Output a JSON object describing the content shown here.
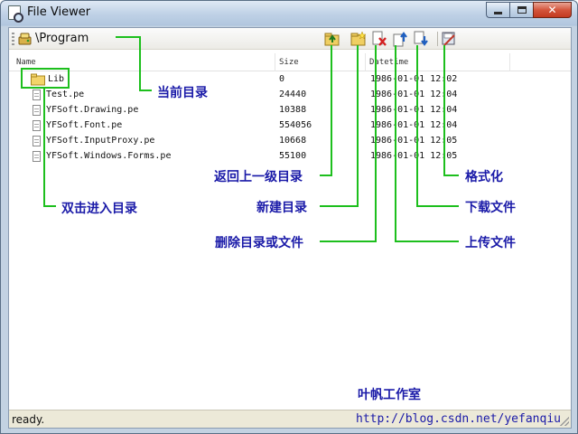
{
  "window": {
    "title": "File Viewer"
  },
  "caption_buttons": {
    "close_glyph": "✕"
  },
  "toolbar": {
    "path": "\\Program",
    "buttons": [
      "go-up-icon",
      "new-folder-icon",
      "delete-icon",
      "upload-icon",
      "download-icon",
      "format-icon"
    ]
  },
  "list": {
    "columns": [
      "Name",
      "Size",
      "Datetime"
    ],
    "rows": [
      {
        "name": "Lib",
        "size": "0",
        "datetime": "1986-01-01 12:02",
        "type": "folder"
      },
      {
        "name": "Test.pe",
        "size": "24440",
        "datetime": "1986-01-01 12:04",
        "type": "file"
      },
      {
        "name": "YFSoft.Drawing.pe",
        "size": "10388",
        "datetime": "1986-01-01 12:04",
        "type": "file"
      },
      {
        "name": "YFSoft.Font.pe",
        "size": "554056",
        "datetime": "1986-01-01 12:04",
        "type": "file"
      },
      {
        "name": "YFSoft.InputProxy.pe",
        "size": "10668",
        "datetime": "1986-01-01 12:05",
        "type": "file"
      },
      {
        "name": "YFSoft.Windows.Forms.pe",
        "size": "55100",
        "datetime": "1986-01-01 12:05",
        "type": "file"
      }
    ]
  },
  "status": {
    "text": "ready."
  },
  "annotations": {
    "current_dir": "当前目录",
    "go_up": "返回上一级目录",
    "new_dir": "新建目录",
    "delete": "删除目录或文件",
    "upload": "上传文件",
    "download": "下载文件",
    "format": "格式化",
    "dblclick": "双击进入目录"
  },
  "watermark": {
    "studio": "叶帆工作室",
    "url": "http://blog.csdn.net/yefanqiu"
  },
  "colors": {
    "annotation_line": "#1dbf1d",
    "annotation_text": "#1a1aa8"
  }
}
